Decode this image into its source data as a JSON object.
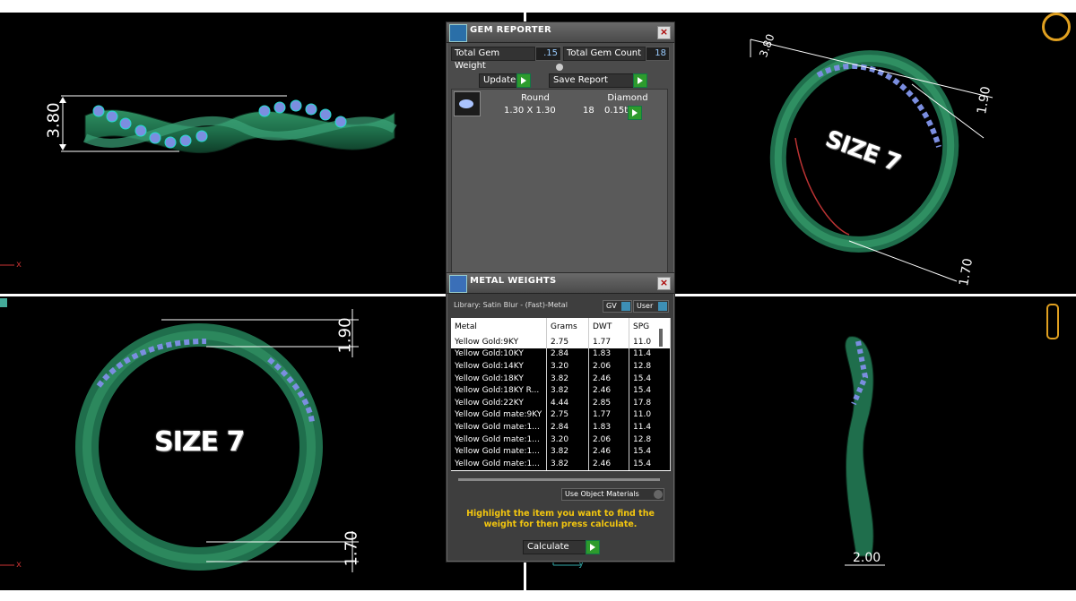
{
  "viewports": {
    "top_left": {
      "dimension": "3.80",
      "axis": "x"
    },
    "top_right": {
      "dimensions": [
        "3.80",
        "1.90",
        "1.70"
      ],
      "size_label": "SIZE 7"
    },
    "bottom_left": {
      "dimensions": [
        "1.90",
        "1.70"
      ],
      "size_label": "SIZE 7",
      "axis": "x"
    },
    "bottom_right": {
      "dimension": "2.00",
      "axis": "y"
    }
  },
  "gem_reporter": {
    "title": "GEM REPORTER",
    "total_weight_label": "Total Gem Weight",
    "total_weight_value": ".15",
    "total_count_label": "Total Gem Count",
    "total_count_value": "18",
    "update_label": "Update",
    "save_report_label": "Save Report",
    "list": {
      "headers": [
        "Round",
        "Diamond"
      ],
      "rows": [
        {
          "size": "1.30 X 1.30",
          "count": "18",
          "weight": "0.15tw"
        }
      ]
    }
  },
  "metal_weights": {
    "title": "METAL WEIGHTS",
    "library": "Library: Satin Blur - (Fast)-Metal",
    "gv_label": "GV",
    "user_label": "User",
    "columns": [
      "Metal",
      "Grams",
      "DWT",
      "SPG"
    ],
    "rows": [
      [
        "Yellow Gold:9KY",
        "2.75",
        "1.77",
        "11.0"
      ],
      [
        "Yellow Gold:10KY",
        "2.84",
        "1.83",
        "11.4"
      ],
      [
        "Yellow Gold:14KY",
        "3.20",
        "2.06",
        "12.8"
      ],
      [
        "Yellow Gold:18KY",
        "3.82",
        "2.46",
        "15.4"
      ],
      [
        "Yellow Gold:18KY R...",
        "3.82",
        "2.46",
        "15.4"
      ],
      [
        "Yellow Gold:22KY",
        "4.44",
        "2.85",
        "17.8"
      ],
      [
        "Yellow Gold mate:9KY",
        "2.75",
        "1.77",
        "11.0"
      ],
      [
        "Yellow Gold mate:1...",
        "2.84",
        "1.83",
        "11.4"
      ],
      [
        "Yellow Gold mate:1...",
        "3.20",
        "2.06",
        "12.8"
      ],
      [
        "Yellow Gold mate:1...",
        "3.82",
        "2.46",
        "15.4"
      ],
      [
        "Yellow Gold mate:1...",
        "3.82",
        "2.46",
        "15.4"
      ]
    ],
    "use_object_materials": "Use Object Materials",
    "hint": "Highlight the item you want to find the weight for then press calculate.",
    "calculate_label": "Calculate"
  }
}
